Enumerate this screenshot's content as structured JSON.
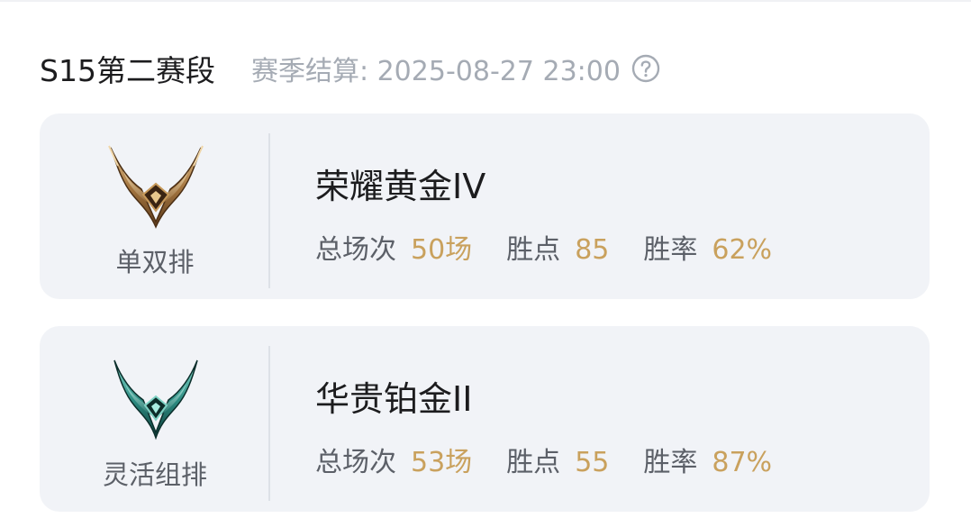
{
  "season": {
    "title": "S15第二赛段",
    "settlement_text": "赛季结算: 2025-08-27 23:00",
    "help_icon": "question-circle-icon"
  },
  "ranks": [
    {
      "queue": "单双排",
      "tier": "荣耀黄金IV",
      "emblem_icon": "gold-rank-emblem-icon",
      "emblem_color": "#b88a4e",
      "stats": {
        "games_label": "总场次",
        "games_value": "50场",
        "lp_label": "胜点",
        "lp_value": "85",
        "winrate_label": "胜率",
        "winrate_value": "62%"
      }
    },
    {
      "queue": "灵活组排",
      "tier": "华贵铂金II",
      "emblem_icon": "platinum-rank-emblem-icon",
      "emblem_color": "#2f8f86",
      "stats": {
        "games_label": "总场次",
        "games_value": "53场",
        "lp_label": "胜点",
        "lp_value": "55",
        "winrate_label": "胜率",
        "winrate_value": "87%"
      }
    }
  ],
  "colors": {
    "card_background": "#f1f3f7",
    "stat_value": "#c9a15d",
    "muted_text": "#a5abb4"
  }
}
